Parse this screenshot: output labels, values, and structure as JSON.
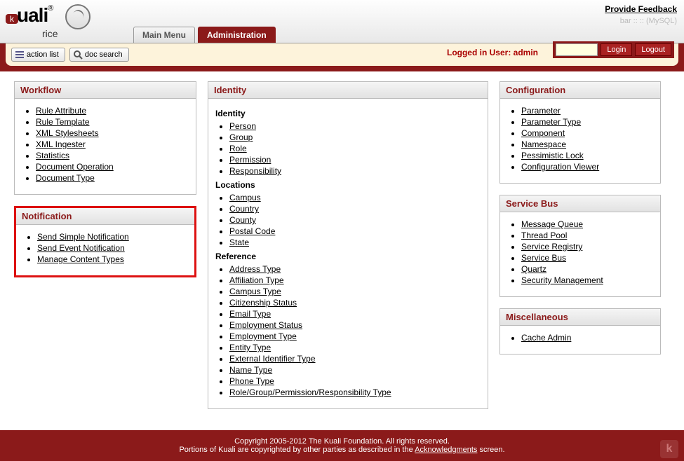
{
  "header": {
    "logo_main": "uali",
    "logo_sub": "rice",
    "feedback": "Provide Feedback",
    "db_info": "bar :: :: (MySQL)"
  },
  "tabs": {
    "main_menu": "Main Menu",
    "administration": "Administration"
  },
  "toolbar": {
    "action_list": "action list",
    "doc_search": "doc search",
    "logged_in": "Logged in User: admin",
    "login": "Login",
    "logout": "Logout"
  },
  "panels": {
    "workflow": {
      "title": "Workflow",
      "items": [
        "Rule Attribute",
        "Rule Template",
        "XML Stylesheets",
        "XML Ingester",
        "Statistics",
        "Document Operation",
        "Document Type"
      ]
    },
    "notification": {
      "title": "Notification",
      "items": [
        "Send Simple Notification",
        "Send Event Notification",
        "Manage Content Types"
      ]
    },
    "identity": {
      "title": "Identity",
      "sub_identity": "Identity",
      "identity_items": [
        "Person",
        "Group",
        "Role",
        "Permission",
        "Responsibility"
      ],
      "sub_locations": "Locations",
      "locations_items": [
        "Campus",
        "Country",
        "County",
        "Postal Code",
        "State"
      ],
      "sub_reference": "Reference",
      "reference_items": [
        "Address Type",
        "Affiliation Type",
        "Campus Type",
        "Citizenship Status",
        "Email Type",
        "Employment Status",
        "Employment Type",
        "Entity Type",
        "External Identifier Type",
        "Name Type",
        "Phone Type",
        "Role/Group/Permission/Responsibility Type"
      ]
    },
    "configuration": {
      "title": "Configuration",
      "items": [
        "Parameter",
        "Parameter Type",
        "Component",
        "Namespace",
        "Pessimistic Lock",
        "Configuration Viewer"
      ]
    },
    "service_bus": {
      "title": "Service Bus",
      "items": [
        "Message Queue",
        "Thread Pool",
        "Service Registry",
        "Service Bus",
        "Quartz",
        "Security Management"
      ]
    },
    "miscellaneous": {
      "title": "Miscellaneous",
      "items": [
        "Cache Admin"
      ]
    }
  },
  "footer": {
    "line1": "Copyright 2005-2012 The Kuali Foundation. All rights reserved.",
    "line2a": "Portions of Kuali are copyrighted by other parties as described in the ",
    "ack_link": "Acknowledgments",
    "line2b": " screen."
  }
}
